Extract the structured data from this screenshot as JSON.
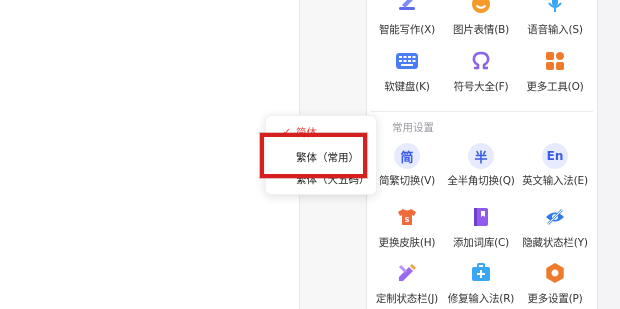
{
  "tools_grid": [
    {
      "label": "智能写作(X)",
      "icon": "pen-write-icon",
      "color": "#5b6cf0"
    },
    {
      "label": "图片表情(B)",
      "icon": "smile-icon",
      "color": "#f39a2b"
    },
    {
      "label": "语音输入(S)",
      "icon": "microphone-icon",
      "color": "#3aa7f5"
    },
    {
      "label": "软键盘(K)",
      "icon": "keyboard-icon",
      "color": "#4b7cf3"
    },
    {
      "label": "符号大全(F)",
      "icon": "omega-icon",
      "color": "#8a63e9"
    },
    {
      "label": "更多工具(O)",
      "icon": "grid-tools-icon",
      "color": "#f07a2b"
    }
  ],
  "settings_section": {
    "title": "常用设置",
    "items": [
      {
        "label": "简繁切换(V)",
        "icon": "simplified-traditional-icon",
        "glyph": "简"
      },
      {
        "label": "全半角切换(Q)",
        "icon": "half-width-icon",
        "glyph": "半"
      },
      {
        "label": "英文输入法(E)",
        "icon": "english-input-icon",
        "glyph": "En"
      },
      {
        "label": "更换皮肤(H)",
        "icon": "skin-shirt-icon",
        "color": "#f06a3a"
      },
      {
        "label": "添加词库(C)",
        "icon": "dictionary-book-icon",
        "color": "#8f5be8"
      },
      {
        "label": "隐藏状态栏(Y)",
        "icon": "hide-eye-icon",
        "color": "#2f7be8"
      },
      {
        "label": "定制状态栏(J)",
        "icon": "custom-pencil-icon",
        "color": "#9a6bf0"
      },
      {
        "label": "修复输入法(R)",
        "icon": "repair-kit-icon",
        "color": "#3aa7f5"
      },
      {
        "label": "更多设置(P)",
        "icon": "settings-gear-icon",
        "color": "#f07a2b"
      }
    ]
  },
  "script_popup": {
    "items": [
      {
        "label": "简体",
        "checked": true
      },
      {
        "label": "繁体（常用）",
        "checked": false
      },
      {
        "label": "繁体（大五码）",
        "checked": false
      }
    ],
    "check_glyph": "✓"
  },
  "colors": {
    "accent_red": "#d61f1f",
    "check_red": "#e2433d",
    "circle_bg": "#e6ebff",
    "circle_fg": "#3a5bea"
  }
}
